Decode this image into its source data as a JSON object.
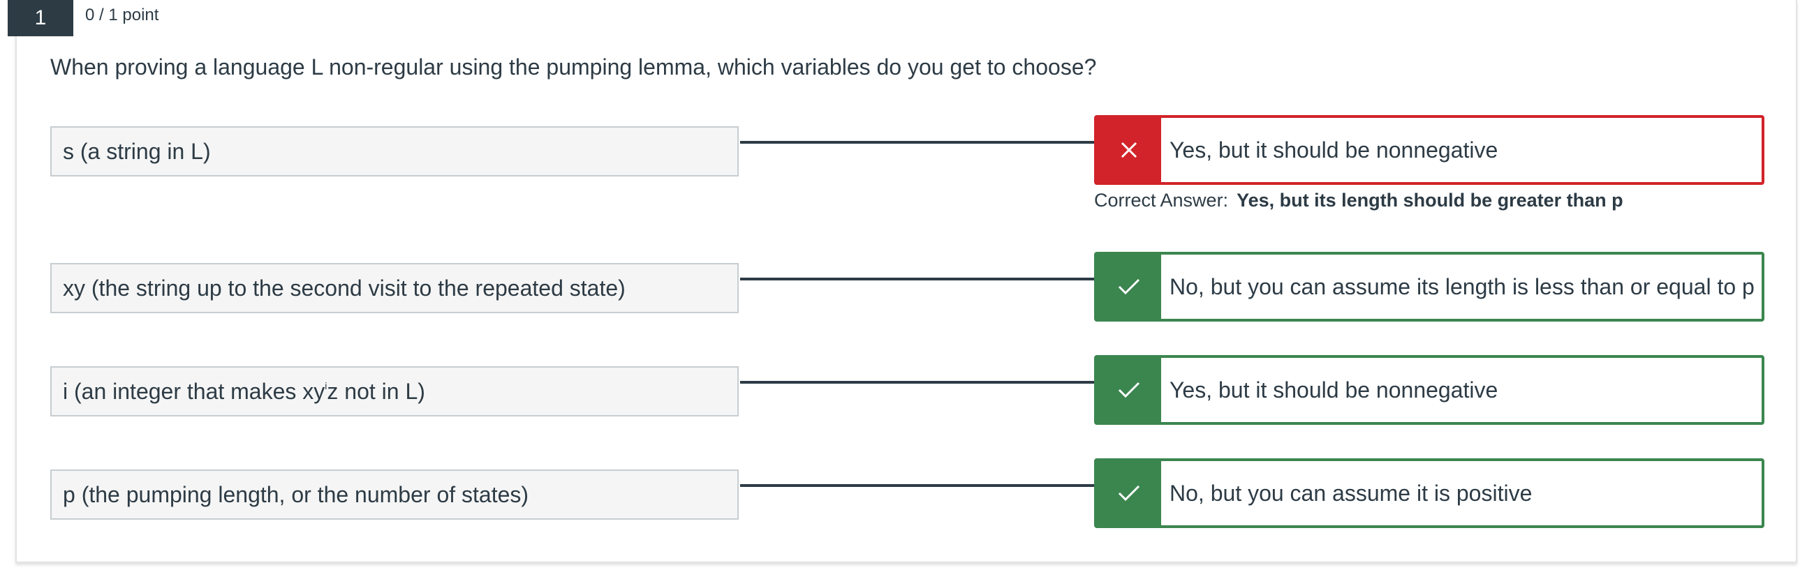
{
  "question": {
    "number": "1",
    "points": "0 / 1 point",
    "text": "When proving a language L non-regular using the pumping lemma, which variables do you get to choose?"
  },
  "matches": [
    {
      "left": "s (a string in L)",
      "answer": "Yes, but it should be nonnegative",
      "status": "incorrect",
      "status_icon": "x-icon",
      "correct_answer_label": "Correct Answer:",
      "correct_answer": "Yes, but its length should be greater than p"
    },
    {
      "left": "xy (the string up to the second visit to the repeated state)",
      "answer": "No, but you can assume its length is less than or equal to p",
      "status": "correct",
      "status_icon": "check-icon"
    },
    {
      "left_prefix": "i (an integer that makes xy",
      "left_sup": "i",
      "left_suffix": "z not in L)",
      "answer": "Yes, but it should be nonnegative",
      "status": "correct",
      "status_icon": "check-icon"
    },
    {
      "left": "p (the pumping length, or the number of states)",
      "answer": "No, but you can assume it is positive",
      "status": "correct",
      "status_icon": "check-icon"
    }
  ],
  "colors": {
    "correct": "#3b864f",
    "incorrect": "#d2232a",
    "header_bg": "#2d3b45",
    "text": "#2d3b45"
  }
}
